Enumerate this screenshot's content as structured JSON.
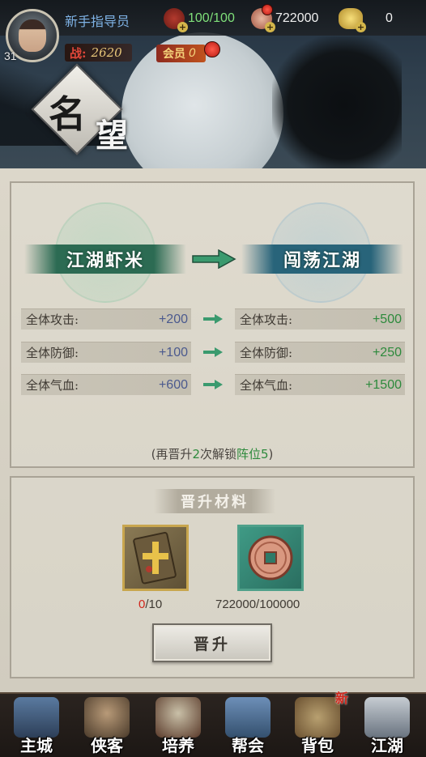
{
  "header": {
    "player_name": "新手指导员",
    "level": "31",
    "stamina": "100/100",
    "copper": "722000",
    "gold": "0",
    "power_label": "战:",
    "power_value": "2620",
    "vip_label": "会员",
    "vip_value": "0",
    "page_title_1": "名",
    "page_title_2": "望"
  },
  "ranks": {
    "current": "江湖虾米",
    "next": "闯荡江湖"
  },
  "stats": [
    {
      "label": "全体攻击:",
      "current": "+200",
      "next": "+500"
    },
    {
      "label": "全体防御:",
      "current": "+100",
      "next": "+250"
    },
    {
      "label": "全体气血:",
      "current": "+600",
      "next": "+1500"
    }
  ],
  "unlock": {
    "prefix": "(再晋升",
    "count": "2",
    "mid": "次解锁",
    "target": "阵位5",
    "suffix": ")"
  },
  "materials": {
    "title": "晋升材料",
    "token_have": "0",
    "token_need": "/10",
    "coin_count": "722000/100000"
  },
  "promote_button": "晋升",
  "nav": {
    "city": "主城",
    "hero": "侠客",
    "train": "培养",
    "guild": "帮会",
    "bag": "背包",
    "world": "江湖",
    "new_badge": "新"
  },
  "colors": {
    "accent_green": "#2d8a3c",
    "stat_blue": "#4b5a8e",
    "alert_red": "#d0261c",
    "name_blue": "#7fb3e6"
  }
}
